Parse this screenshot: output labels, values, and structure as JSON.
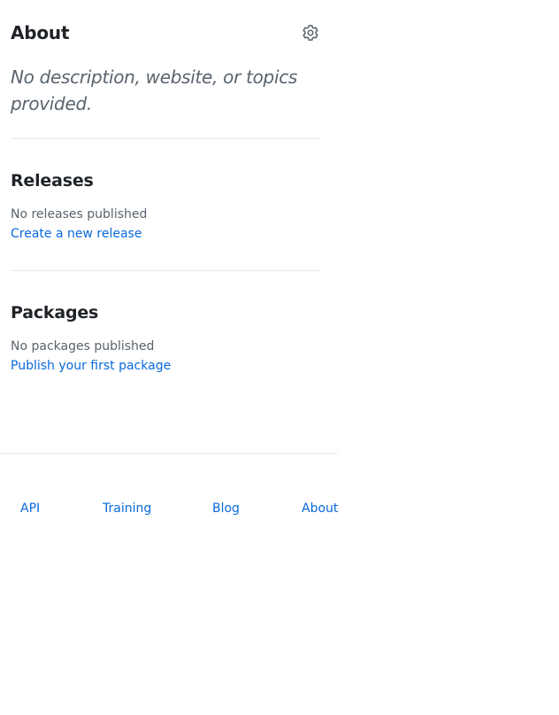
{
  "about": {
    "title": "About",
    "settings_icon": "gear-icon",
    "description": "No description, website, or topics provided."
  },
  "releases": {
    "title": "Releases",
    "empty_text": "No releases published",
    "create_link": "Create a new release"
  },
  "packages": {
    "title": "Packages",
    "empty_text": "No packages published",
    "publish_link": "Publish your first package"
  },
  "footer": {
    "links": [
      {
        "label": "API"
      },
      {
        "label": "Training"
      },
      {
        "label": "Blog"
      },
      {
        "label": "About"
      }
    ]
  },
  "colors": {
    "link": "#0969da",
    "muted": "#59636e",
    "heading": "#1f2328",
    "divider": "#e6e8eb"
  }
}
